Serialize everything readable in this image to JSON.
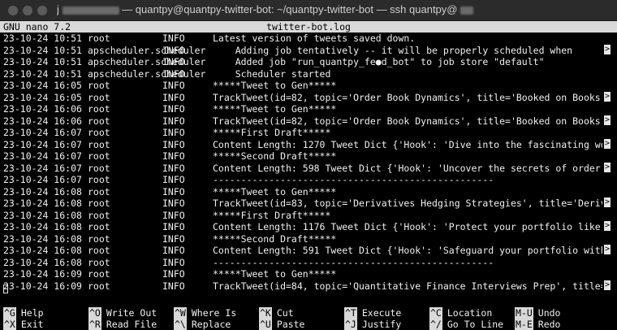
{
  "window": {
    "title_prefix": "j",
    "title_suffix": "— quantpy@quantpy-twitter-bot: ~/quantpy-twitter-bot — ssh quantpy@"
  },
  "nano": {
    "version": "GNU nano 7.2",
    "filename": "twitter-bot.log"
  },
  "log_lines": [
    {
      "date": "23-10-24 10:51",
      "logger": "root",
      "level": "INFO",
      "msg": "Latest version of tweets saved down.",
      "trunc": false
    },
    {
      "date": "23-10-24 10:51",
      "logger": "apscheduler.scheduler",
      "level": "INFO",
      "msg": "    Adding job tentatively -- it will be properly scheduled when",
      "trunc": true
    },
    {
      "date": "23-10-24 10:51",
      "logger": "apscheduler.scheduler",
      "level": "INFO",
      "msg": "    Added job \"run_quantpy_fe●d_bot\" to job store \"default\"",
      "trunc": false
    },
    {
      "date": "23-10-24 10:51",
      "logger": "apscheduler.scheduler",
      "level": "INFO",
      "msg": "    Scheduler started",
      "trunc": false
    },
    {
      "date": "23-10-24 16:05",
      "logger": "root",
      "level": "INFO",
      "msg": "*****Tweet to Gen*****",
      "trunc": false
    },
    {
      "date": "23-10-24 16:05",
      "logger": "root",
      "level": "INFO",
      "msg": "TrackTweet(id=82, topic='Order Book Dynamics', title='Booked on Books:",
      "trunc": true
    },
    {
      "date": "23-10-24 16:06",
      "logger": "root",
      "level": "INFO",
      "msg": "*****Tweet to Gen*****",
      "trunc": false
    },
    {
      "date": "23-10-24 16:06",
      "logger": "root",
      "level": "INFO",
      "msg": "TrackTweet(id=82, topic='Order Book Dynamics', title='Booked on Books:",
      "trunc": true
    },
    {
      "date": "23-10-24 16:07",
      "logger": "root",
      "level": "INFO",
      "msg": "*****First Draft*****",
      "trunc": false
    },
    {
      "date": "23-10-24 16:07",
      "logger": "root",
      "level": "INFO",
      "msg": "Content Length: 1270 Tweet Dict {'Hook': 'Dive into the fascinating wo",
      "trunc": true
    },
    {
      "date": "23-10-24 16:07",
      "logger": "root",
      "level": "INFO",
      "msg": "*****Second Draft*****",
      "trunc": false
    },
    {
      "date": "23-10-24 16:07",
      "logger": "root",
      "level": "INFO",
      "msg": "Content Length: 598 Tweet Dict {'Hook': 'Uncover the secrets of order",
      "trunc": true
    },
    {
      "date": "23-10-24 16:07",
      "logger": "root",
      "level": "INFO",
      "msg": "--------------------------------------------------",
      "trunc": false
    },
    {
      "date": "23-10-24 16:08",
      "logger": "root",
      "level": "INFO",
      "msg": "*****Tweet to Gen*****",
      "trunc": false
    },
    {
      "date": "23-10-24 16:08",
      "logger": "root",
      "level": "INFO",
      "msg": "TrackTweet(id=83, topic='Derivatives Hedging Strategies', title='Deriv",
      "trunc": true
    },
    {
      "date": "23-10-24 16:08",
      "logger": "root",
      "level": "INFO",
      "msg": "*****First Draft*****",
      "trunc": false
    },
    {
      "date": "23-10-24 16:08",
      "logger": "root",
      "level": "INFO",
      "msg": "Content Length: 1176 Tweet Dict {'Hook': 'Protect your portfolio like",
      "trunc": true
    },
    {
      "date": "23-10-24 16:08",
      "logger": "root",
      "level": "INFO",
      "msg": "*****Second Draft*****",
      "trunc": false
    },
    {
      "date": "23-10-24 16:08",
      "logger": "root",
      "level": "INFO",
      "msg": "Content Length: 591 Tweet Dict {'Hook': 'Safeguard your portfolio with",
      "trunc": true
    },
    {
      "date": "23-10-24 16:08",
      "logger": "root",
      "level": "INFO",
      "msg": "--------------------------------------------------",
      "trunc": false
    },
    {
      "date": "23-10-24 16:09",
      "logger": "root",
      "level": "INFO",
      "msg": "*****Tweet to Gen*****",
      "trunc": false
    },
    {
      "date": "23-10-24 16:09",
      "logger": "root",
      "level": "INFO",
      "msg": "TrackTweet(id=84, topic='Quantitative Finance Interviews Prep', title=",
      "trunc": true
    }
  ],
  "truncation_marker": ">",
  "shortcuts": [
    {
      "key": "^G",
      "label": "Help"
    },
    {
      "key": "^O",
      "label": "Write Out"
    },
    {
      "key": "^W",
      "label": "Where Is"
    },
    {
      "key": "^K",
      "label": "Cut"
    },
    {
      "key": "^T",
      "label": "Execute"
    },
    {
      "key": "^C",
      "label": "Location"
    },
    {
      "key": "M-U",
      "label": "Undo"
    },
    {
      "key": "^X",
      "label": "Exit"
    },
    {
      "key": "^R",
      "label": "Read File"
    },
    {
      "key": "^\\",
      "label": "Replace"
    },
    {
      "key": "^U",
      "label": "Paste"
    },
    {
      "key": "^J",
      "label": "Justify"
    },
    {
      "key": "^/",
      "label": "Go To Line"
    },
    {
      "key": "M-E",
      "label": "Redo"
    }
  ]
}
